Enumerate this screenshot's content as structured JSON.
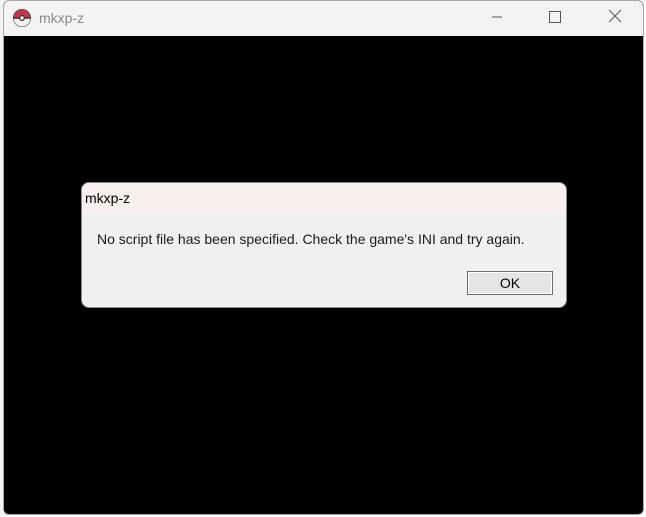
{
  "window": {
    "title": "mkxp-z",
    "icon": "pokeball-icon",
    "controls": {
      "minimize_icon": "minimize-icon",
      "maximize_icon": "maximize-icon",
      "close_icon": "close-icon"
    }
  },
  "dialog": {
    "title": "mkxp-z",
    "message": "No script file has been specified. Check the game's INI and try again.",
    "ok_label": "OK"
  },
  "colors": {
    "game_background": "#000000",
    "titlebar": "#f3f3f3",
    "dialog_titlebar": "#f8f0ee",
    "dialog_body": "#f0f0f0",
    "icon_red": "#c0394a",
    "icon_dark": "#3a3a3a"
  }
}
